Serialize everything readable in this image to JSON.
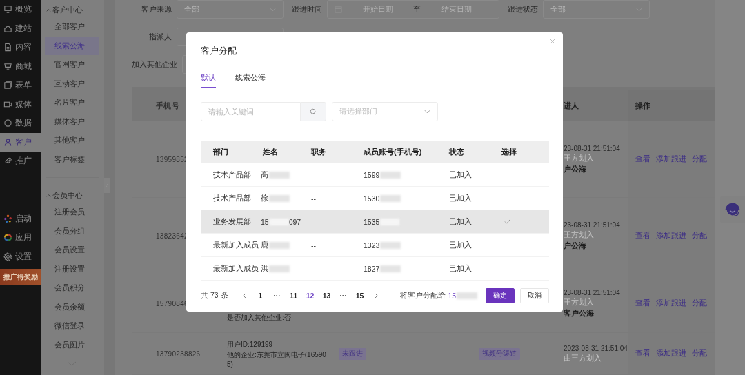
{
  "rail": {
    "items": [
      {
        "label": "概览",
        "selected": false
      },
      {
        "label": "建站",
        "selected": false
      },
      {
        "label": "内容",
        "selected": false
      },
      {
        "label": "商城",
        "selected": false
      },
      {
        "label": "表单",
        "selected": false
      },
      {
        "label": "媒体",
        "selected": false
      },
      {
        "label": "数据",
        "selected": false
      },
      {
        "label": "客户",
        "selected": true
      },
      {
        "label": "推广",
        "selected": false
      }
    ],
    "tools": [
      {
        "label": "启动"
      },
      {
        "label": "应用"
      },
      {
        "label": "设置"
      }
    ],
    "promo": "推广得奖励"
  },
  "subnav": {
    "groups": [
      {
        "title": "客户中心",
        "expanded": true,
        "items": [
          {
            "label": "全部客户",
            "selected": false
          },
          {
            "label": "线索公海",
            "selected": true
          },
          {
            "label": "官网客户",
            "selected": false
          },
          {
            "label": "互动客户",
            "selected": false
          },
          {
            "label": "名片客户",
            "selected": false
          },
          {
            "label": "媒体客户",
            "selected": false
          },
          {
            "label": "其他客户",
            "selected": false
          },
          {
            "label": "客户标签",
            "selected": false
          }
        ]
      },
      {
        "title": "会员中心",
        "expanded": true,
        "items": [
          {
            "label": "注册会员",
            "selected": false
          },
          {
            "label": "会员分组",
            "selected": false
          },
          {
            "label": "会员设置",
            "selected": false
          },
          {
            "label": "注册设置",
            "selected": false
          },
          {
            "label": "会员积分",
            "selected": false
          },
          {
            "label": "会员余额",
            "selected": false
          },
          {
            "label": "微信登录",
            "selected": false
          },
          {
            "label": "会员图片",
            "selected": false
          }
        ]
      }
    ]
  },
  "filters": [
    [
      {
        "label": "客户来源",
        "kind": "select",
        "placeholder": "全部"
      },
      {
        "label": "跟进时间",
        "kind": "daterange",
        "start": "开始日期",
        "separator": "至",
        "end": "结束日期"
      },
      {
        "label": "跟进状态",
        "kind": "select",
        "placeholder": "全部"
      }
    ],
    [
      {
        "label": "指派人",
        "kind": "select"
      }
    ],
    [
      {
        "label": "加入其他企业",
        "kind": "select"
      }
    ]
  ],
  "table": {
    "columns": {
      "phone": "手机号",
      "follow": "进人",
      "actions": "操作"
    },
    "rows": [
      {
        "phone": "13959852",
        "info": [],
        "follow": [
          {
            "kind": "time",
            "text": "23-08-31 21:51:04"
          },
          {
            "kind": "note",
            "text": "王方划入"
          },
          {
            "kind": "pool",
            "text": "户公海"
          }
        ],
        "actions": [
          "查看",
          "添加跟进",
          "分配"
        ]
      },
      {
        "phone": "13823642",
        "info": [],
        "follow": [
          {
            "kind": "time",
            "text": "23-08-31 21:51:04"
          },
          {
            "kind": "note",
            "text": "王方划入"
          },
          {
            "kind": "pool",
            "text": "户公海"
          }
        ],
        "actions": [
          "查看",
          "添加跟进",
          "分配"
        ]
      },
      {
        "phone": "15790846",
        "info": [
          "是否加入其他企业:否"
        ],
        "follow": [
          {
            "kind": "time",
            "text": "23-08-31 21:51:04"
          },
          {
            "kind": "note",
            "text": "王方划入"
          },
          {
            "kind": "pool",
            "text": "客户公海"
          }
        ],
        "actions": [
          "查看",
          "添加跟进",
          "分配"
        ]
      },
      {
        "phone": "13790238826",
        "info": [
          "用户ID:129199",
          "他的企业:东莞市立闽电子(16590",
          "5)"
        ],
        "status": "未跟进",
        "channel": "视频号渠道",
        "follow": [
          {
            "kind": "time",
            "text": "2023-08-31 21:51:04"
          },
          {
            "kind": "note",
            "text": "由王方划入"
          }
        ],
        "actions": [
          "查看",
          "添加跟进",
          "分配"
        ]
      }
    ]
  },
  "dialog": {
    "title": "客户分配",
    "tabs": [
      {
        "label": "默认",
        "selected": true
      },
      {
        "label": "线索公海",
        "selected": false
      }
    ],
    "search": {
      "placeholder": "请输入关键词"
    },
    "department": {
      "placeholder": "请选择部门"
    },
    "columns": [
      "部门",
      "姓名",
      "职务",
      "成员账号(手机号)",
      "状态",
      "选择"
    ],
    "rows": [
      {
        "dept": "技术产品部",
        "name": [
          "高"
        ],
        "title": "--",
        "account": [
          "1599"
        ],
        "status": "已加入",
        "selected": false
      },
      {
        "dept": "技术产品部",
        "name": [
          "徐"
        ],
        "title": "--",
        "account": [
          "1530"
        ],
        "status": "已加入",
        "selected": false
      },
      {
        "dept": "业务发展部",
        "name": [
          "15",
          "097"
        ],
        "title": "--",
        "account": [
          "1535"
        ],
        "status": "已加入",
        "selected": true
      },
      {
        "dept": "最新加入成员",
        "name": [
          "鹿"
        ],
        "title": "--",
        "account": [
          "1323"
        ],
        "status": "已加入",
        "selected": false
      },
      {
        "dept": "最新加入成员",
        "name": [
          "洪"
        ],
        "title": "--",
        "account": [
          "1827"
        ],
        "status": "已加入",
        "selected": false
      }
    ],
    "total": "共 73 条",
    "pages": [
      {
        "label": "1",
        "selected": false
      },
      {
        "label": "···",
        "selected": false
      },
      {
        "label": "11",
        "selected": false
      },
      {
        "label": "12",
        "selected": true
      },
      {
        "label": "13",
        "selected": false
      },
      {
        "label": "···",
        "selected": false
      },
      {
        "label": "15",
        "selected": false
      }
    ],
    "assign_label": "将客户分配给",
    "assignee": "15",
    "buttons": [
      {
        "label": "确定",
        "kind": "primary"
      },
      {
        "label": "取消",
        "kind": "default"
      }
    ]
  }
}
